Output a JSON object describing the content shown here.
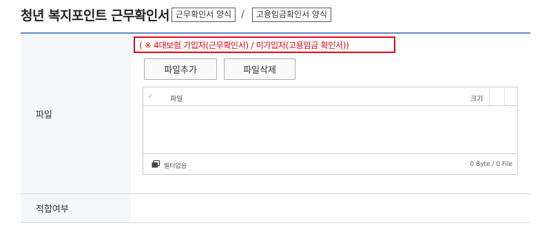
{
  "header": {
    "title": "청년 복지포인트 근무확인서",
    "link_work_form": "근무확인서 양식",
    "separator": "/",
    "link_employment_form": "고용임금확인서 양식"
  },
  "file_row": {
    "label": "파일",
    "notice": "( ※ 4대보험 가입자(근무확인서) / 미가입자(고용임금 확인서))",
    "add_button": "파일추가",
    "delete_button": "파일삭제",
    "uploader": {
      "col_file": "파일",
      "col_size": "크기",
      "filter_label": "필터없음",
      "stats": "0 Byte / 0 File",
      "files": []
    }
  },
  "eligible_row": {
    "label": "적합여부",
    "value": ""
  },
  "colors": {
    "accent_line": "#5f86c4",
    "notice_red": "#e60012",
    "header_cell_bg": "#f4f6fa"
  },
  "icons": {
    "check": "check-icon",
    "filter": "filter-icon"
  }
}
